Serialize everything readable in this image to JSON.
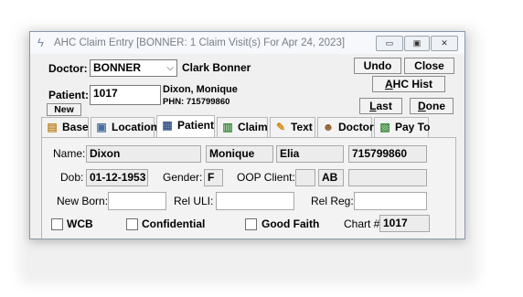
{
  "window": {
    "title": "AHC Claim Entry [BONNER: 1 Claim Visit(s) For Apr 24, 2023]",
    "app_icon": "lightning-icon",
    "controls": [
      "minimize-icon",
      "maximize-icon",
      "close-icon"
    ]
  },
  "header": {
    "doctor_label": "Doctor:",
    "doctor_value": "BONNER",
    "doctor_name": "Clark Bonner",
    "patient_label": "Patient:",
    "patient_value": "1017",
    "patient_name": "Dixon, Monique",
    "phn": "PHN: 715799860",
    "new_label": "New"
  },
  "actions": {
    "undo": "Undo",
    "close": "Close",
    "ahc_hist_prefix": "A",
    "ahc_hist_rest": "HC Hist",
    "last_prefix": "L",
    "last_rest": "ast",
    "done_prefix": "D",
    "done_rest": "one"
  },
  "tabs": [
    {
      "label": "Base",
      "icon": "document-icon"
    },
    {
      "label": "Location",
      "icon": "monitor-icon"
    },
    {
      "label": "Patient",
      "icon": "patient-card-icon",
      "active": true
    },
    {
      "label": "Claim",
      "icon": "claim-form-icon"
    },
    {
      "label": "Text",
      "icon": "pencil-icon"
    },
    {
      "label": "Doctor",
      "icon": "doctor-icon"
    },
    {
      "label": "Pay To",
      "icon": "payment-icon"
    }
  ],
  "patient_tab": {
    "name_label": "Name:",
    "last_name": "Dixon",
    "first_name": "Monique",
    "middle_name": "Elia",
    "phn": "715799860",
    "dob_label": "Dob:",
    "dob": "01-12-1953",
    "gender_label": "Gender:",
    "gender": "F",
    "oop_label": "OOP Client:",
    "oop_value": "",
    "province": "AB",
    "province_extra": "",
    "newborn_label": "New Born:",
    "newborn_value": "",
    "rel_uli_label": "Rel ULI:",
    "rel_uli_value": "",
    "rel_reg_label": "Rel Reg:",
    "rel_reg_value": "",
    "wcb_label": "WCB",
    "confidential_label": "Confidential",
    "good_faith_label": "Good Faith",
    "chart_label": "Chart #",
    "chart_value": "1017"
  }
}
